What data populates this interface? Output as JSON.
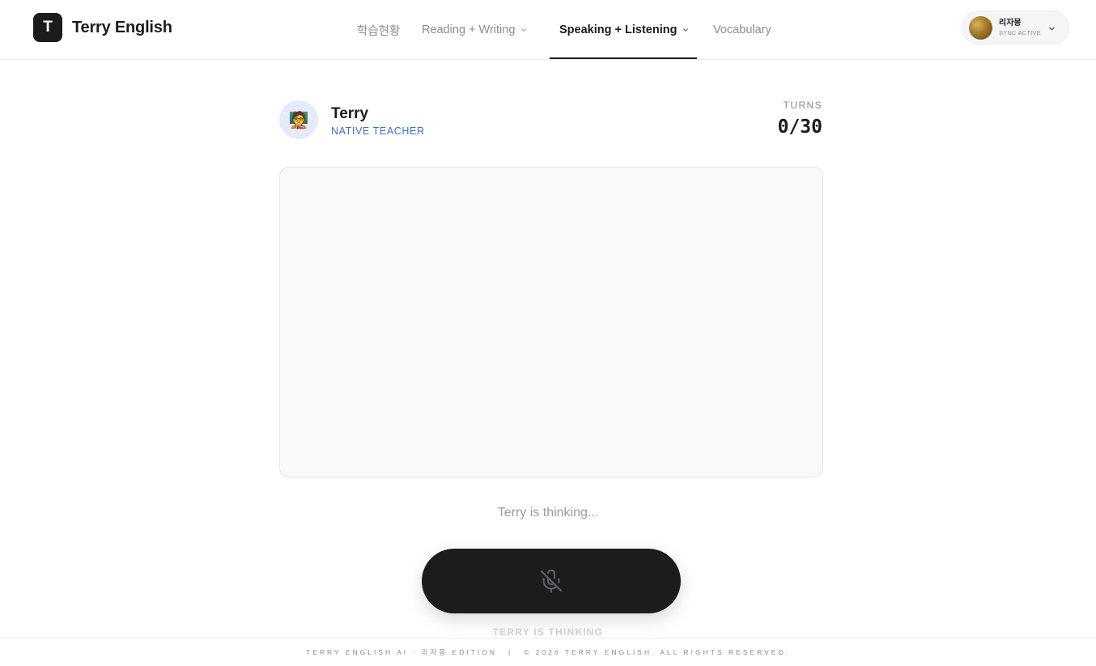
{
  "header": {
    "brand_letter": "T",
    "brand_name": "Terry English",
    "nav": [
      {
        "label": "학습현황",
        "has_dropdown": false,
        "active": false
      },
      {
        "label": "Reading + Writing",
        "has_dropdown": true,
        "active": false
      },
      {
        "label": "Speaking + Listening",
        "has_dropdown": true,
        "active": true
      },
      {
        "label": "Vocabulary",
        "has_dropdown": false,
        "active": false
      }
    ],
    "profile": {
      "name": "리자몽",
      "status": "SYNC ACTIVE"
    }
  },
  "teacher": {
    "avatar_emoji": "🧑‍🏫",
    "name": "Terry",
    "role": "NATIVE TEACHER"
  },
  "turns": {
    "label": "TURNS",
    "value": "0/30"
  },
  "status": {
    "thinking_text": "Terry is thinking...",
    "mic_caption": "TERRY IS THINKING",
    "mic_icon": "mic-off-icon"
  },
  "footer": {
    "left": "TERRY ENGLISH AI · 리자몽 EDITION",
    "separator": "|",
    "right": "© 2026 TERRY ENGLISH. ALL RIGHTS RESERVED."
  },
  "colors": {
    "primary": "#1c1c1e",
    "accent_blue": "#3b6fd4",
    "muted": "#8b8b92",
    "avatar_bg": "#e4ebfb"
  }
}
